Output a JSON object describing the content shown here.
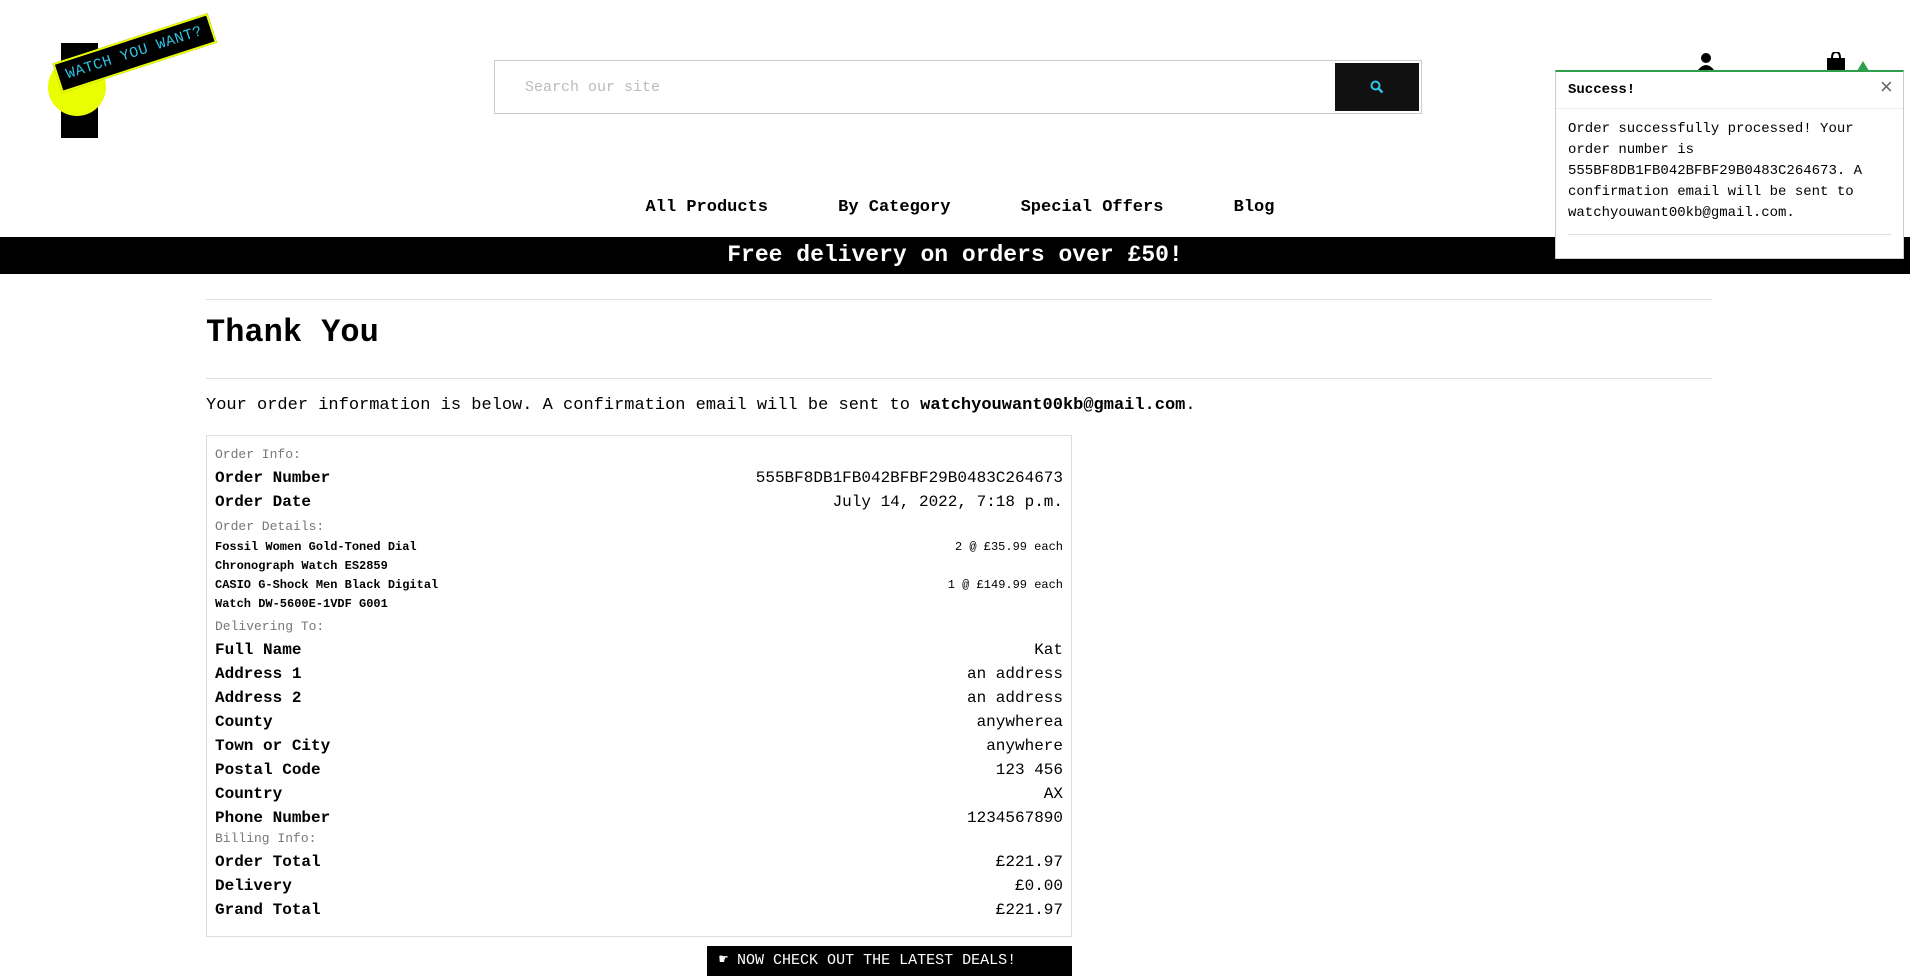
{
  "brand": {
    "logo_text": "WATCH YOU WANT?"
  },
  "search": {
    "placeholder": "Search our site"
  },
  "nav": {
    "items": [
      "All Products",
      "By Category",
      "Special Offers",
      "Blog"
    ]
  },
  "banner": {
    "text": "Free delivery on orders over £50!"
  },
  "page": {
    "title": "Thank You",
    "intro_prefix": "Your order information is below. A confirmation email will be sent to ",
    "intro_email": "watchyouwant00kb@gmail.com",
    "intro_suffix": "."
  },
  "order": {
    "order_info_label": "Order Info:",
    "order_number_label": "Order Number",
    "order_number": "555BF8DB1FB042BFBF29B0483C264673",
    "order_date_label": "Order Date",
    "order_date": "July 14, 2022, 7:18 p.m.",
    "order_details_label": "Order Details:",
    "items": [
      {
        "name": "Fossil Women Gold-Toned Dial Chronograph Watch ES2859",
        "qty": "2 @ £35.99 each"
      },
      {
        "name": "CASIO G-Shock Men Black Digital Watch DW-5600E-1VDF G001",
        "qty": "1 @ £149.99 each"
      }
    ],
    "delivering_label": "Delivering To:",
    "delivery": [
      {
        "label": "Full Name",
        "value": "Kat"
      },
      {
        "label": "Address 1",
        "value": "an address"
      },
      {
        "label": "Address 2",
        "value": "an address"
      },
      {
        "label": "County",
        "value": "anywherea"
      },
      {
        "label": "Town or City",
        "value": "anywhere"
      },
      {
        "label": "Postal Code",
        "value": "123 456"
      },
      {
        "label": "Country",
        "value": "AX"
      },
      {
        "label": "Phone Number",
        "value": "1234567890"
      }
    ],
    "billing_label": "Billing Info:",
    "billing": [
      {
        "label": "Order Total",
        "value": "£221.97"
      },
      {
        "label": "Delivery",
        "value": "£0.00"
      },
      {
        "label": "Grand Total",
        "value": "£221.97"
      }
    ]
  },
  "cta": {
    "text": "NOW CHECK OUT THE LATEST DEALS!"
  },
  "toast": {
    "title": "Success!",
    "close": "×",
    "message": "Order successfully processed! Your order number is 555BF8DB1FB042BFBF29B0483C264673. A confirmation email will be sent to watchyouwant00kb@gmail.com."
  },
  "colors": {
    "accent_yellow": "#e9ff00",
    "accent_cyan": "#2ec4e6",
    "success_green": "#2e9e4a"
  },
  "icons": {
    "search": "search-icon",
    "account": "user-icon",
    "bag": "shopping-bag-icon"
  }
}
